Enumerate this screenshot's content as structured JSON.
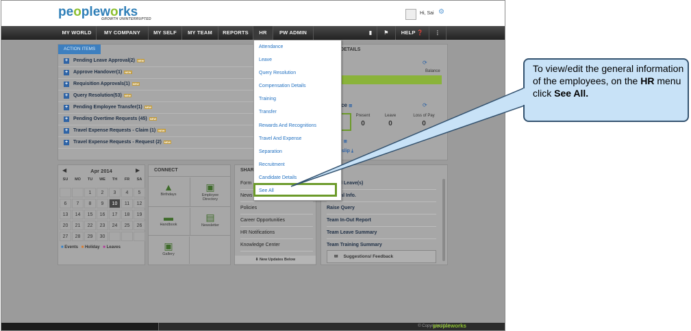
{
  "header": {
    "logo_text": "peopleworks",
    "tagline": "GROWTH UNINTERRUPTED",
    "greeting": "Hi, Sai"
  },
  "nav": {
    "items": [
      "MY WORLD",
      "MY COMPANY",
      "MY SELF",
      "MY TEAM",
      "REPORTS",
      "HR",
      "PW ADMIN"
    ],
    "help": "HELP"
  },
  "action_items": {
    "tab": "ACTION ITEMS",
    "rows": [
      "Pending Leave Approval(2)",
      "Approve Handover(1)",
      "Requisition Approvals(1)",
      "Query Resolution(53)",
      "Pending Employee Transfer(1)",
      "Pending Overtime Requests (45)",
      "Travel Expense Requests - Claim (1)",
      "Travel Expense Requests - Request (2)"
    ],
    "new_tag": "NEW"
  },
  "details": {
    "title": "DETAILS",
    "leave_partial": "e",
    "balance_label": "Balance",
    "attendance_title": "ndance",
    "present_label": "Present",
    "present_value": "0",
    "leave_label": "Leave",
    "leave_value": "0",
    "lop_label": "Loss of Pay",
    "lop_value": "0",
    "salary_partial": "y",
    "payslip": "yslip"
  },
  "calendar": {
    "month": "Apr 2014",
    "days": [
      "SU",
      "MO",
      "TU",
      "WE",
      "TH",
      "FR",
      "SA"
    ],
    "weeks": [
      [
        "",
        "",
        "1",
        "2",
        "3",
        "4",
        "5"
      ],
      [
        "6",
        "7",
        "8",
        "9",
        "10",
        "11",
        "12"
      ],
      [
        "13",
        "14",
        "15",
        "16",
        "17",
        "18",
        "19"
      ],
      [
        "20",
        "21",
        "22",
        "23",
        "24",
        "25",
        "26"
      ],
      [
        "27",
        "28",
        "29",
        "30",
        "",
        "",
        ""
      ]
    ],
    "today": "10",
    "legend": [
      "Events",
      "Holiday",
      "Leaves"
    ]
  },
  "connect": {
    "title": "CONNECT",
    "tiles": [
      "Birthdays",
      "Employee Directory",
      "Handbook",
      "Newsletter",
      "Gallery"
    ]
  },
  "share": {
    "title": "SHAR",
    "items": [
      "Form",
      "News",
      "Policies",
      "Career Opportunities",
      "HR Notifications",
      "Knowledge Center"
    ],
    "more": "New Updates Below"
  },
  "links": {
    "items": [
      "Cancel Leave(s)",
      "General Info.",
      "Raise Query",
      "Team In-Out Report",
      "Team Leave Summary",
      "Team Training Summary"
    ],
    "feedback": "Suggestions/ Feedback"
  },
  "hr_menu": {
    "items": [
      "Attendance",
      "Leave",
      "Query Resolution",
      "Compensation Details",
      "Training",
      "Transfer",
      "Rewards And Recognitions",
      "Travel And Expense",
      "Separation",
      "Recruitment",
      "Candidate Details",
      "See All"
    ]
  },
  "footer": {
    "copyright": "© Copyright 2014",
    "logo": "peopleworks"
  },
  "callout": {
    "line1": "To view/edit the general information of the employees, on the ",
    "bold1": "HR",
    "line2": " menu click ",
    "bold2": "See All."
  },
  "colors": {
    "accent": "#3d7fbf",
    "highlight": "#6b9a29",
    "callout_bg": "#c8e2f7"
  }
}
